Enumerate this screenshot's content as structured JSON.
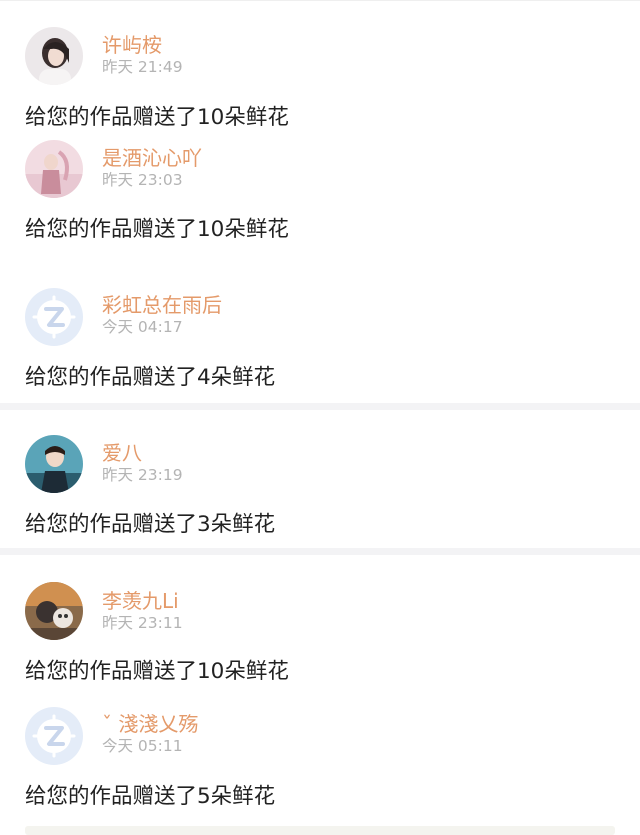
{
  "notifications": [
    {
      "username": "许屿桉",
      "time": "昨天 21:49",
      "message": "给您的作品赠送了10朵鲜花",
      "avatar": "girl-photo-avatar"
    },
    {
      "username": "是酒沁心吖",
      "time": "昨天 23:03",
      "message": "给您的作品赠送了10朵鲜花",
      "avatar": "pink-photo-avatar"
    },
    {
      "username": "彩虹总在雨后",
      "time": "今天 04:17",
      "message": "给您的作品赠送了4朵鲜花",
      "avatar": "default-z-avatar"
    },
    {
      "username": "爱八",
      "time": "昨天 23:19",
      "message": "给您的作品赠送了3朵鲜花",
      "avatar": "boy-photo-avatar"
    },
    {
      "username": "李羡九Li",
      "time": "昨天 23:11",
      "message": "给您的作品赠送了10朵鲜花",
      "avatar": "cartoon-photo-avatar"
    },
    {
      "username": "ˇ 淺淺乂殇",
      "time": "今天 05:11",
      "message": "给您的作品赠送了5朵鲜花",
      "avatar": "default-z-avatar"
    }
  ],
  "colors": {
    "username": "#e49a6a",
    "time": "#b4b4b4",
    "message": "#222222",
    "default_avatar_bg": "#e4ecf8",
    "default_avatar_fg": "#ffffff",
    "divider": "#f3f3f5"
  }
}
